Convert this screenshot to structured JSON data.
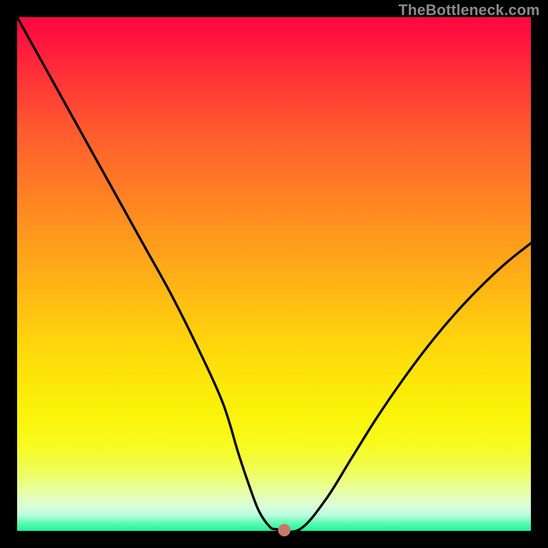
{
  "watermark": "TheBottleneck.com",
  "chart_data": {
    "type": "line",
    "title": "",
    "xlabel": "",
    "ylabel": "",
    "xlim": [
      0,
      100
    ],
    "ylim": [
      0,
      100
    ],
    "grid": false,
    "legend": false,
    "series": [
      {
        "name": "bottleneck-curve",
        "x": [
          0,
          5,
          10,
          15,
          20,
          25,
          30,
          35,
          40,
          43,
          45,
          47,
          49,
          50.5,
          55,
          60,
          65,
          70,
          75,
          80,
          85,
          90,
          95,
          100
        ],
        "y": [
          100,
          91,
          82,
          73,
          64,
          55,
          46,
          36,
          25,
          15.3,
          9.3,
          4,
          1,
          0.3,
          0.3,
          6,
          14,
          22,
          29.3,
          36,
          42,
          47.3,
          52,
          56
        ]
      }
    ],
    "min_point": {
      "x": 52,
      "y": 0.2
    },
    "background": {
      "type": "vertical-gradient",
      "stops": [
        {
          "pos": 0.0,
          "color": "#fe093f"
        },
        {
          "pos": 0.5,
          "color": "#ffae17"
        },
        {
          "pos": 0.83,
          "color": "#f7fb1c"
        },
        {
          "pos": 1.0,
          "color": "#17f79b"
        }
      ]
    },
    "frame_color": "#000000",
    "curve_color": "#000000",
    "min_dot_color": "#c9766b"
  }
}
